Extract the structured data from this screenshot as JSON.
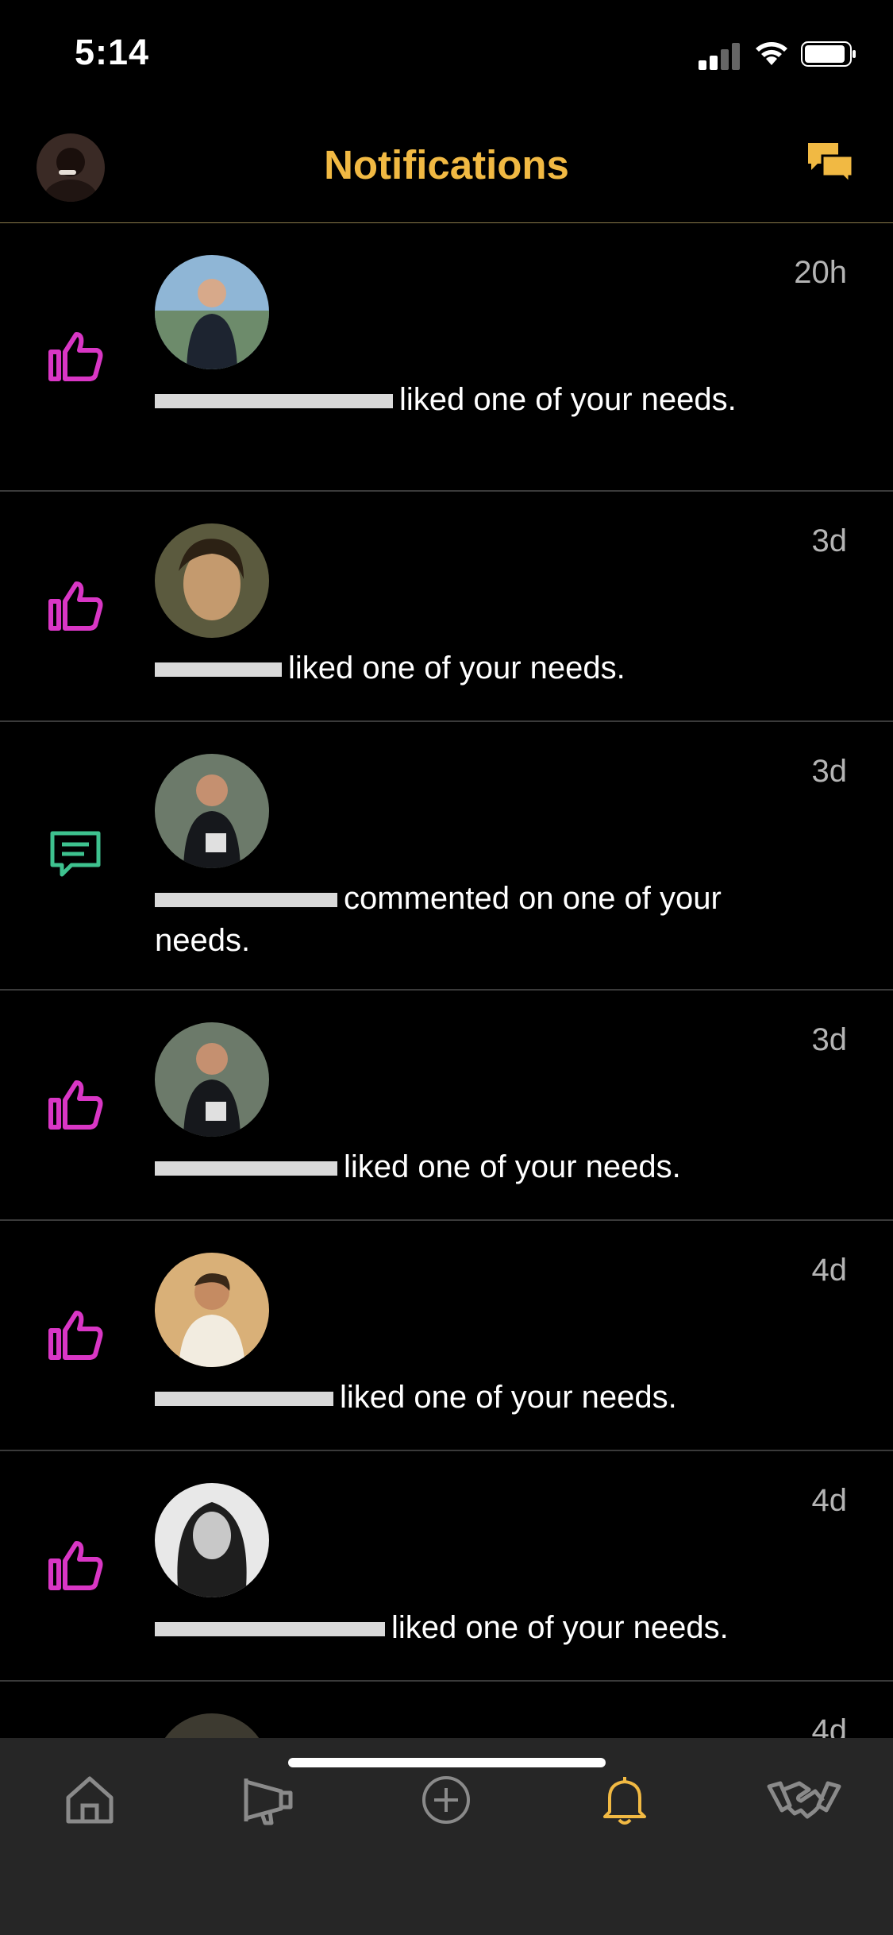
{
  "status_bar": {
    "time": "5:14"
  },
  "header": {
    "title": "Notifications"
  },
  "colors": {
    "accent": "#f1b943",
    "like": "#d936c5",
    "comment": "#3ec28f",
    "tab_inactive": "#8a8a8a"
  },
  "notifications": [
    {
      "type": "like",
      "time": "20h",
      "action": "liked one of your needs."
    },
    {
      "type": "like",
      "time": "3d",
      "action": "liked one of your needs."
    },
    {
      "type": "comment",
      "time": "3d",
      "action": "commented on one of your needs."
    },
    {
      "type": "like",
      "time": "3d",
      "action": "liked one of your needs."
    },
    {
      "type": "like",
      "time": "4d",
      "action": "liked one of your needs."
    },
    {
      "type": "like",
      "time": "4d",
      "action": "liked one of your needs."
    },
    {
      "type": "like",
      "time": "4d",
      "action": ""
    }
  ],
  "tabbar": {
    "items": [
      {
        "icon": "home-icon"
      },
      {
        "icon": "megaphone-icon"
      },
      {
        "icon": "add-icon"
      },
      {
        "icon": "bell-icon",
        "active": true
      },
      {
        "icon": "handshake-icon"
      }
    ]
  }
}
